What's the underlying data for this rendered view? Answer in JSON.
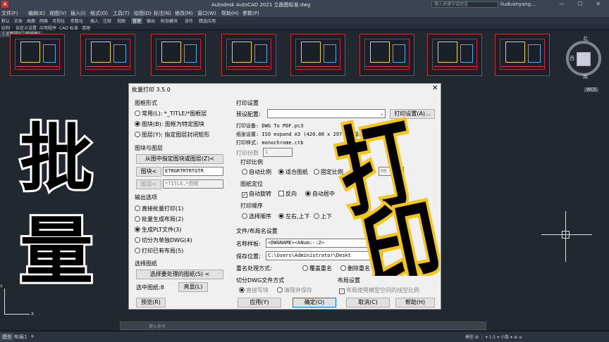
{
  "app": {
    "title": "Autodesk AutoCAD 2021    立面图标准.dwg",
    "search_placeholder": "键入关键字或短语",
    "user": "liuduanyang...",
    "win_buttons": "— ☐ ✕"
  },
  "menu": [
    "文件(F)",
    "编辑(E)",
    "视图(V)",
    "插入(I)",
    "格式(O)",
    "工具(T)",
    "绘图(D)",
    "标注(N)",
    "修改(M)",
    "窗口(W)",
    "帮助(H)",
    "参数(P)"
  ],
  "ribbon_tabs": [
    "默认",
    "实体",
    "曲面",
    "网格",
    "可视化",
    "参数化",
    "插入",
    "注释",
    "视图",
    "管理",
    "输出",
    "附加模块",
    "协作",
    "精选应用"
  ],
  "ribbon_active": "管理",
  "ribbon_row2": [
    "绘制",
    "自定义设置",
    "应用程序",
    "CAD 标准",
    "清理"
  ],
  "drawing_tab": "[-][俯视][二维线框]",
  "compass": {
    "north": "北",
    "west": "西",
    "south": "南",
    "wcs": "WCS"
  },
  "ucs": {
    "y": "Y",
    "x": "X"
  },
  "command": {
    "placeholder": "键入命令"
  },
  "status": {
    "model": "模型",
    "layout1": "布局1",
    "add": "+",
    "right": "模型  ⊞  ⋮  ▾  1:1 ▾  小数 ▾  ⊕  ≡"
  },
  "overlay": {
    "pi": "批",
    "liang": "量",
    "da": "打",
    "yin": "印"
  },
  "dialog": {
    "title": "批量打印 3.5.0",
    "close": "✕",
    "frame_section": "图框形式",
    "frame_options": [
      "常用(L): *_TITLE/*图框层",
      "图块(B): 图框为特定图块",
      "图层(Y): 指定图层封闭矩形"
    ],
    "block_section": "图块与图层",
    "pick_btn": "从图中指定图块或图层(Z)<",
    "block_btn": "图块<",
    "block_value": "ETRGRTRTRTGTR",
    "layer_btn": "图层<",
    "layer_value": "*TITLE,*图框",
    "output_section": "输出选项",
    "output_options": [
      "直接批量打印(1)",
      "批量生成布局(2)",
      "生成PLT文件(3)",
      "切分为单独DWG(4)",
      "打印已有布局(5)"
    ],
    "select_section": "选择图纸",
    "select_btn": "选择要处理的图纸(S) <",
    "selected_label": "选中图纸:8",
    "highlight_btn": "亮显(L)",
    "preview_btn": "预览(R)",
    "print_section": "打印设置",
    "preset_label": "预设配置:",
    "print_setting_btn": "打印设置(A)...",
    "printer": "打印设备: DWG To PDF.pc3",
    "paper": "纸张设置: ISO expand A3 (420.00 x 297.00 毫米)",
    "style": "打印样式: monochrome.ctb",
    "copies_label": "打印份数",
    "copies_value": "1",
    "scale_section": "打印比例",
    "scale_options": [
      "自动比例",
      "适合图纸",
      "固定比例"
    ],
    "scale_value": "00",
    "pos_section": "图纸定位",
    "auto_rotate": "自动旋转",
    "reverse": "反向",
    "auto_center": "自动居中",
    "order_section": "打印顺序",
    "order_options": [
      "选择顺序",
      "左右,上下",
      "上下"
    ],
    "name_section": "文件/布局名设置",
    "name_label": "名称样板:",
    "name_value": "<DWGNAME><ANum:-:2>",
    "ext_value": "pdf",
    "path_label": "保存位置:",
    "path_value": "C:\\Users\\Administrator\\Deskt",
    "rename_label": "重名处理方式:",
    "rename_options": [
      "覆盖重名",
      "删除重名",
      "自动编号顺延"
    ],
    "split_section": "切分DWG文件方式",
    "split_options": [
      "直接写块",
      "清理并保存"
    ],
    "layout_section": "布局设置",
    "layout_check": "布局使用模型空间的线型比例",
    "apply_btn": "应用(Y)",
    "ok_btn": "确定(O)",
    "cancel_btn": "取消(C)",
    "help_btn": "帮助(H)"
  }
}
